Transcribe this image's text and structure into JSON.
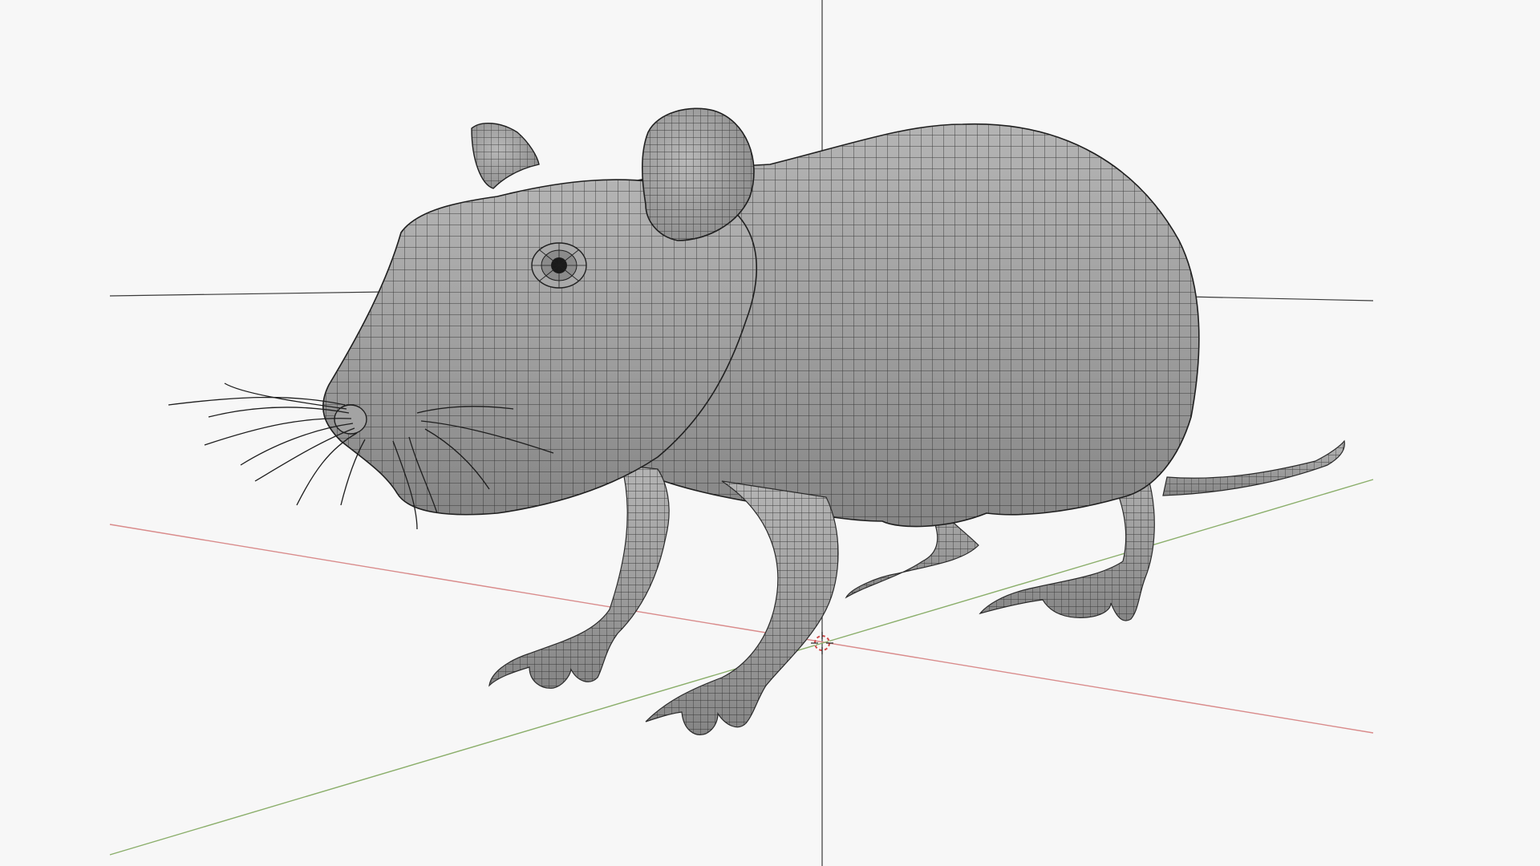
{
  "viewport": {
    "background_color": "#f7f7f7",
    "axis_colors": {
      "x_axis": "#d98b8b",
      "y_axis": "#8aae6a",
      "vertical_guide": "#333333",
      "horizon_guide": "#333333"
    },
    "model": {
      "object_type": "rat",
      "display_mode": "wireframe-on-shaded",
      "mesh_color": "#9a9a9a",
      "wire_color": "#222222"
    },
    "icons": {
      "origin": "3d-cursor-icon"
    }
  }
}
